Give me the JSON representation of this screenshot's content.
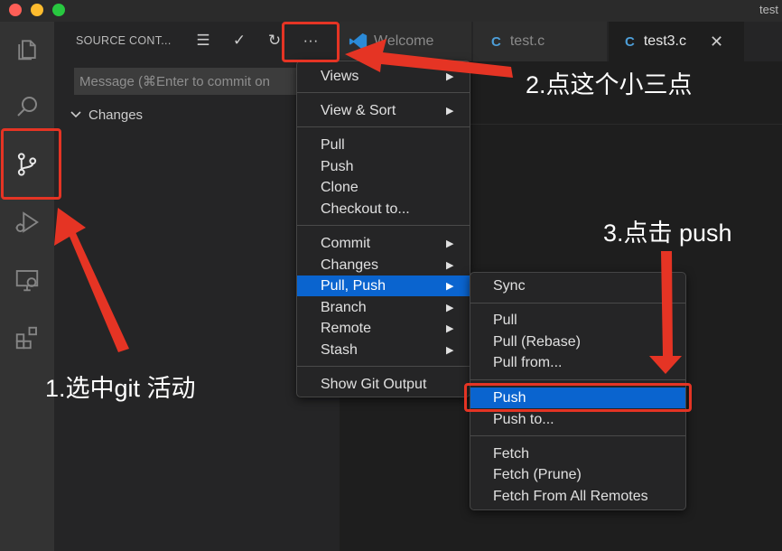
{
  "window": {
    "title": "test"
  },
  "activity_bar": {
    "items": [
      {
        "icon": "files-icon"
      },
      {
        "icon": "search-icon"
      },
      {
        "icon": "source-control-icon"
      },
      {
        "icon": "run-debug-icon"
      },
      {
        "icon": "remote-explorer-icon"
      },
      {
        "icon": "extensions-icon"
      }
    ]
  },
  "sidebar": {
    "title": "SOURCE CONT...",
    "commit_placeholder": "Message (⌘Enter to commit on",
    "changes_label": "Changes",
    "icons": {
      "tree": "☰",
      "commit": "✓",
      "refresh": "↻",
      "more": "···"
    }
  },
  "tabs": [
    {
      "label": "Welcome",
      "icon": "vscode-logo-icon",
      "active": false
    },
    {
      "label": "test.c",
      "icon_text": "C",
      "active": false
    },
    {
      "label": "test3.c",
      "icon_text": "C",
      "active": true,
      "close": "✕"
    }
  ],
  "main_menu": {
    "groups": [
      [
        {
          "label": "Views",
          "submenu": true
        }
      ],
      [
        {
          "label": "View & Sort",
          "submenu": true
        }
      ],
      [
        {
          "label": "Pull"
        },
        {
          "label": "Push"
        },
        {
          "label": "Clone"
        },
        {
          "label": "Checkout to..."
        }
      ],
      [
        {
          "label": "Commit",
          "submenu": true
        },
        {
          "label": "Changes",
          "submenu": true
        },
        {
          "label": "Pull, Push",
          "submenu": true,
          "highlighted": true
        },
        {
          "label": "Branch",
          "submenu": true
        },
        {
          "label": "Remote",
          "submenu": true
        },
        {
          "label": "Stash",
          "submenu": true
        }
      ],
      [
        {
          "label": "Show Git Output"
        }
      ]
    ],
    "arrow_glyph": "▶"
  },
  "submenu": {
    "groups": [
      [
        {
          "label": "Sync"
        }
      ],
      [
        {
          "label": "Pull"
        },
        {
          "label": "Pull (Rebase)"
        },
        {
          "label": "Pull from..."
        }
      ],
      [
        {
          "label": "Push",
          "highlighted": true
        },
        {
          "label": "Push to..."
        }
      ],
      [
        {
          "label": "Fetch"
        },
        {
          "label": "Fetch (Prune)"
        },
        {
          "label": "Fetch From All Remotes"
        }
      ]
    ]
  },
  "annotations": {
    "step1": "1.选中git 活动",
    "step2": "2.点这个小三点",
    "step3": "3.点击 push",
    "color": "#e53424"
  }
}
